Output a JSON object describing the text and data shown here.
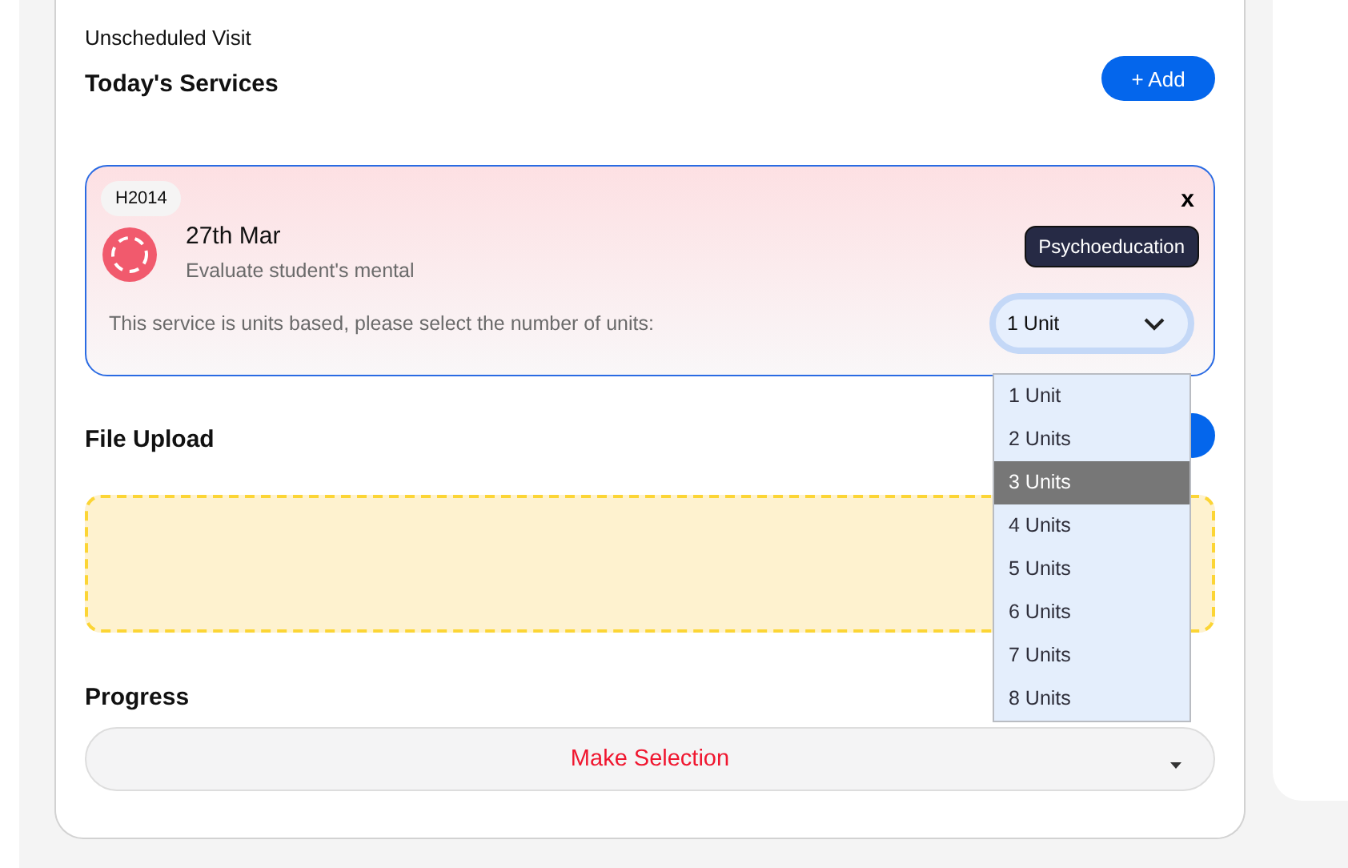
{
  "visit_type": "Unscheduled Visit",
  "services": {
    "title": "Today's Services",
    "add_button": "+ Add",
    "items": [
      {
        "code": "H2014",
        "close": "x",
        "date": "27th Mar",
        "description": "Evaluate student's mental",
        "category": "Psychoeducation",
        "units_prompt": "This service is units based, please select the number of units:",
        "units_value": "1 Unit",
        "dropdown_open": true,
        "options": [
          {
            "label": "1 Unit",
            "highlighted": false
          },
          {
            "label": "2 Units",
            "highlighted": false
          },
          {
            "label": "3 Units",
            "highlighted": true
          },
          {
            "label": "4 Units",
            "highlighted": false
          },
          {
            "label": "5 Units",
            "highlighted": false
          },
          {
            "label": "6 Units",
            "highlighted": false
          },
          {
            "label": "7 Units",
            "highlighted": false
          },
          {
            "label": "8 Units",
            "highlighted": false
          }
        ]
      }
    ]
  },
  "file_upload": {
    "title": "File Upload"
  },
  "progress": {
    "title": "Progress",
    "placeholder": "Make Selection"
  }
}
